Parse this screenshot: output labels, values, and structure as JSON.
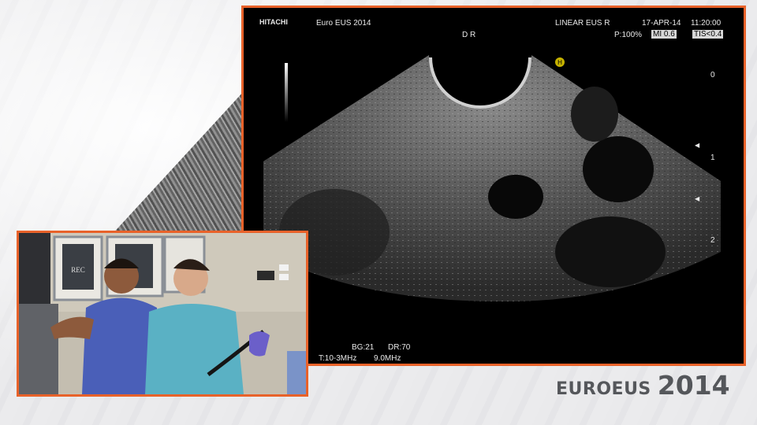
{
  "ultrasound": {
    "manufacturer": "HITACHI",
    "event": "Euro EUS 2014",
    "orientation": "D R",
    "mode": "LINEAR EUS R",
    "date": "17-APR-14",
    "time": "11:20:00",
    "power": "P:100%",
    "mi": "MI 0.6",
    "tis": "TIS<0.4",
    "probe_marker": "H",
    "bg": "BG:21",
    "dr": "DR:70",
    "frequency_range": "T:10-3MHz",
    "frequency": "9.0MHz",
    "depth_labels": [
      "0",
      "1",
      "2"
    ]
  },
  "video": {
    "rec_label": "REC"
  },
  "brand": {
    "name": "EUROEUS",
    "year": "2014"
  },
  "colors": {
    "accent_border": "#e8622a",
    "brand_text": "#55575b"
  }
}
